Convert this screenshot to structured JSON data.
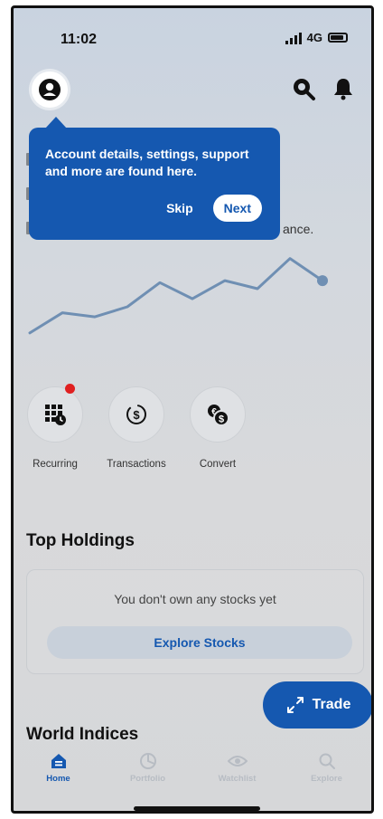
{
  "status_bar": {
    "time": "11:02",
    "network": "4G"
  },
  "tooltip": {
    "text": "Account details, settings, support and more are found here.",
    "skip_label": "Skip",
    "next_label": "Next"
  },
  "obscured": {
    "fragment": "ance."
  },
  "chart_data": {
    "type": "line",
    "x": [
      0,
      1,
      2,
      3,
      4,
      5,
      6,
      7,
      8,
      9
    ],
    "values": [
      10,
      30,
      26,
      36,
      60,
      44,
      62,
      54,
      84,
      62
    ],
    "color": "#6f8fb3"
  },
  "quick_actions": [
    {
      "label": "Recurring",
      "icon": "recurring-icon",
      "badge": true
    },
    {
      "label": "Transactions",
      "icon": "transactions-icon",
      "badge": false
    },
    {
      "label": "Convert",
      "icon": "convert-icon",
      "badge": false
    }
  ],
  "top_holdings": {
    "title": "Top Holdings",
    "empty_text": "You don't own any stocks yet",
    "explore_label": "Explore Stocks"
  },
  "trade": {
    "label": "Trade"
  },
  "world_indices": {
    "title": "World Indices"
  },
  "tabs": [
    {
      "label": "Home",
      "icon": "home-icon",
      "active": true
    },
    {
      "label": "Portfolio",
      "icon": "portfolio-icon",
      "active": false
    },
    {
      "label": "Watchlist",
      "icon": "watchlist-icon",
      "active": false
    },
    {
      "label": "Explore",
      "icon": "explore-icon",
      "active": false
    }
  ],
  "colors": {
    "accent": "#1558b0",
    "badge": "#e02020"
  }
}
